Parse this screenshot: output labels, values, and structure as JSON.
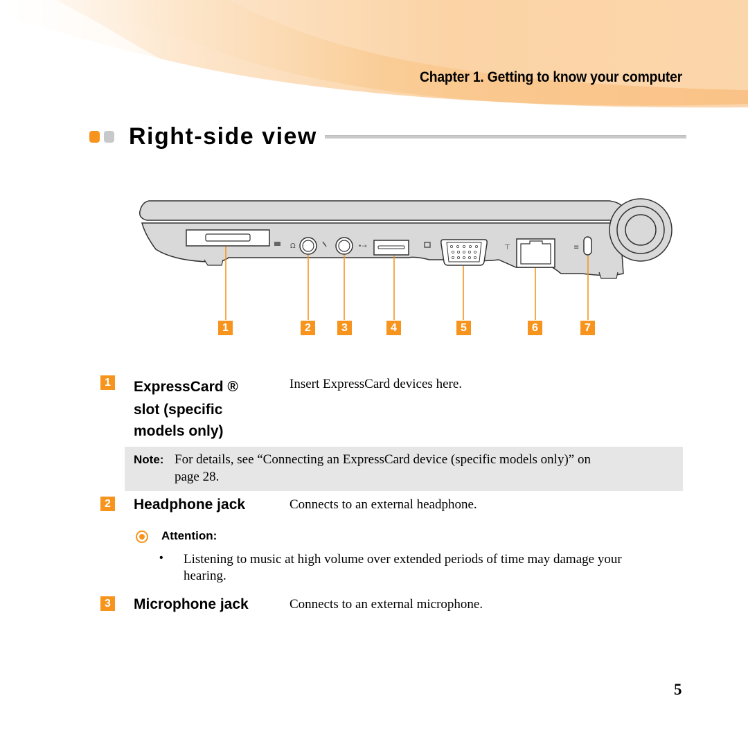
{
  "header": {
    "chapter_title": "Chapter 1. Getting to know your computer",
    "accent_color": "#f7941d"
  },
  "section": {
    "title": "Right-side view"
  },
  "diagram": {
    "description": "Right side of laptop with labeled ports",
    "callouts": [
      "1",
      "2",
      "3",
      "4",
      "5",
      "6",
      "7"
    ],
    "port_icons": [
      "expresscard-icon",
      "headphone-icon",
      "microphone-icon",
      "usb-icon",
      "vga-monitor-icon",
      "network-icon",
      "kensington-lock-icon"
    ]
  },
  "items": [
    {
      "number": "1",
      "term_lines": [
        "ExpressCard ®",
        "slot (specific",
        "models only)"
      ],
      "description": "Insert ExpressCard devices here."
    },
    {
      "number": "2",
      "term": "Headphone jack",
      "description": "Connects to an external headphone."
    },
    {
      "number": "3",
      "term": "Microphone jack",
      "description": "Connects to an external microphone."
    }
  ],
  "note": {
    "label": "Note:",
    "text": "For details, see “Connecting an ExpressCard device (specific models only)” on",
    "text_line2": "page 28."
  },
  "attention": {
    "label": "Attention:",
    "bullet": "•",
    "text": "Listening to music at high volume over extended periods of time may damage your hearing."
  },
  "page": {
    "number": "5"
  }
}
